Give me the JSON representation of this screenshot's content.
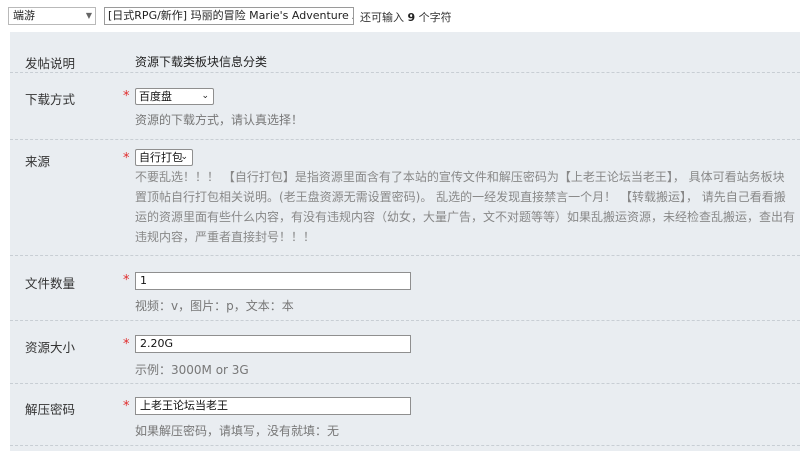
{
  "topbar": {
    "category_value": "端游",
    "title_value": "[日式RPG/新作] 玛丽的冒险 Marie's Adventure AI汉化步",
    "remain_prefix": "还可输入 ",
    "remain_count": "9",
    "remain_suffix": " 个字符"
  },
  "form": {
    "intro": {
      "label": "发帖说明",
      "text": "资源下载类板块信息分类"
    },
    "download": {
      "label": "下载方式",
      "required": "*",
      "selected": "百度盘",
      "hint": "资源的下载方式，请认真选择！"
    },
    "source": {
      "label": "来源",
      "required": "*",
      "selected": "自行打包",
      "hint_lines": [
        "不要乱选！！！ 【自行打包】是指资源里面含有了本站的宣传文件和解压密码为【上老王论坛当老王】， 具体可看站务板块",
        "置顶帖自行打包相关说明。(老王盘资源无需设置密码)。 乱选的一经发现直接禁言一个月！ 【转载搬运】， 请先自己看看搬",
        "运的资源里面有些什么内容，有没有违规内容（幼女，大量广告，文不对题等等）如果乱搬运资源，未经检查乱搬运，查出有",
        "违规内容，严重者直接封号！！！"
      ]
    },
    "file_count": {
      "label": "文件数量",
      "required": "*",
      "value": "1",
      "hint": "视频：v，图片：p，文本：本"
    },
    "size": {
      "label": "资源大小",
      "required": "*",
      "value": "2.20G",
      "hint": "示例：3000M or 3G"
    },
    "password": {
      "label": "解压密码",
      "required": "*",
      "value": "上老王论坛当老王",
      "hint": "如果解压密码，请填写，没有就填：无"
    }
  }
}
